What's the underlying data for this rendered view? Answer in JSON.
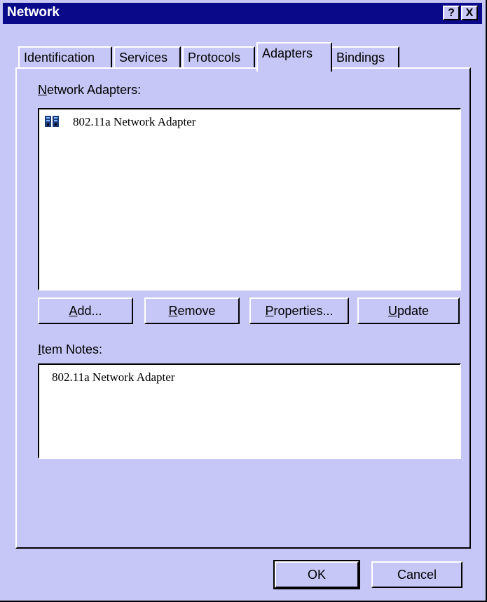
{
  "window": {
    "title": "Network",
    "help_glyph": "?",
    "close_glyph": "X"
  },
  "tabs": [
    {
      "label": "Identification"
    },
    {
      "label": "Services"
    },
    {
      "label": "Protocols"
    },
    {
      "label": "Adapters",
      "active": true
    },
    {
      "label": "Bindings"
    }
  ],
  "adapters": {
    "label_hotkey": "N",
    "label_rest": "etwork Adapters:",
    "items": [
      {
        "label": "802.11a Network Adapter",
        "icon": "network-adapter-icon"
      }
    ]
  },
  "buttons": {
    "add": {
      "hotkey": "A",
      "rest": "dd..."
    },
    "remove": {
      "hotkey": "R",
      "rest": "emove"
    },
    "properties": {
      "hotkey": "P",
      "rest": "roperties..."
    },
    "update": {
      "hotkey": "U",
      "rest": "pdate"
    }
  },
  "notes": {
    "label_hotkey": "I",
    "label_rest": "tem Notes:",
    "text": "802.11a Network Adapter"
  },
  "footer": {
    "ok_label": "OK",
    "cancel_label": "Cancel"
  },
  "colors": {
    "face": "#c7c7f7",
    "titlebar": "#09098a",
    "field": "#ffffff"
  }
}
